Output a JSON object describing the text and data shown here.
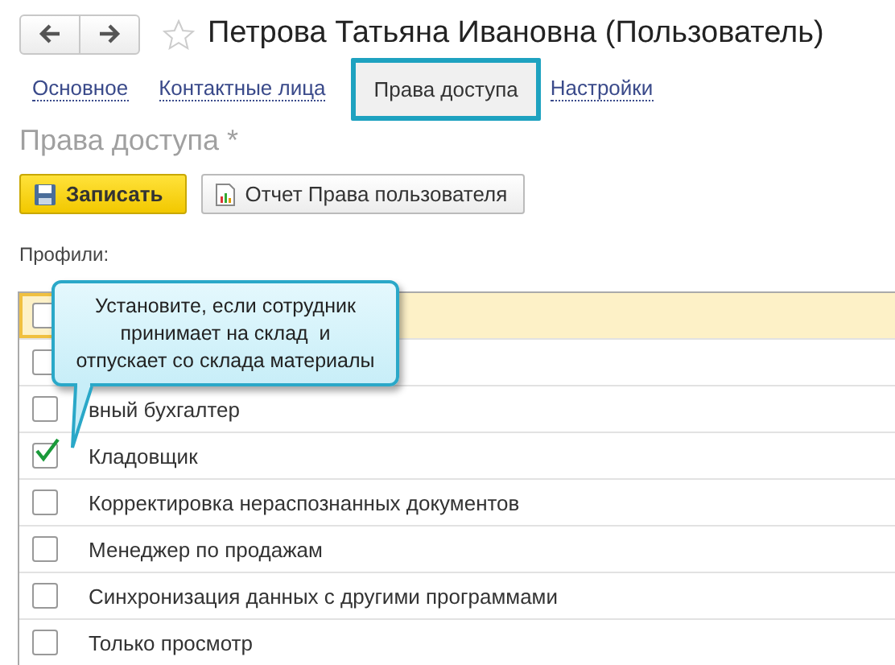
{
  "window": {
    "title": "Петрова Татьяна Ивановна (Пользователь)",
    "favorite": false
  },
  "tabs": [
    {
      "label": "Основное",
      "selected": false
    },
    {
      "label": "Контактные лица",
      "selected": false
    },
    {
      "label": "Права доступа",
      "selected": true
    },
    {
      "label": "Настройки",
      "selected": false
    }
  ],
  "section_title": "Права доступа *",
  "buttons": [
    {
      "kind": "save",
      "label": "Записать"
    },
    {
      "kind": "report",
      "label": "Отчет Права пользователя"
    }
  ],
  "profiles_label": "Профили:",
  "profiles": [
    {
      "checked": false,
      "selected": true
    },
    {
      "checked": false,
      "selected": false
    },
    {
      "label": "вный бухгалтер",
      "checked": false,
      "selected": false
    },
    {
      "label": "Кладовщик",
      "checked": true,
      "selected": false
    },
    {
      "label": "Корректировка нераспознанных документов",
      "checked": false,
      "selected": false
    },
    {
      "label": "Менеджер по продажам",
      "checked": false,
      "selected": false
    },
    {
      "label": "Синхронизация данных с другими программами",
      "checked": false,
      "selected": false
    },
    {
      "label": "Только просмотр",
      "checked": false,
      "selected": false
    }
  ],
  "tooltip": "Установите, если сотрудник принимает на склад  и отпускает со склада материалы"
}
